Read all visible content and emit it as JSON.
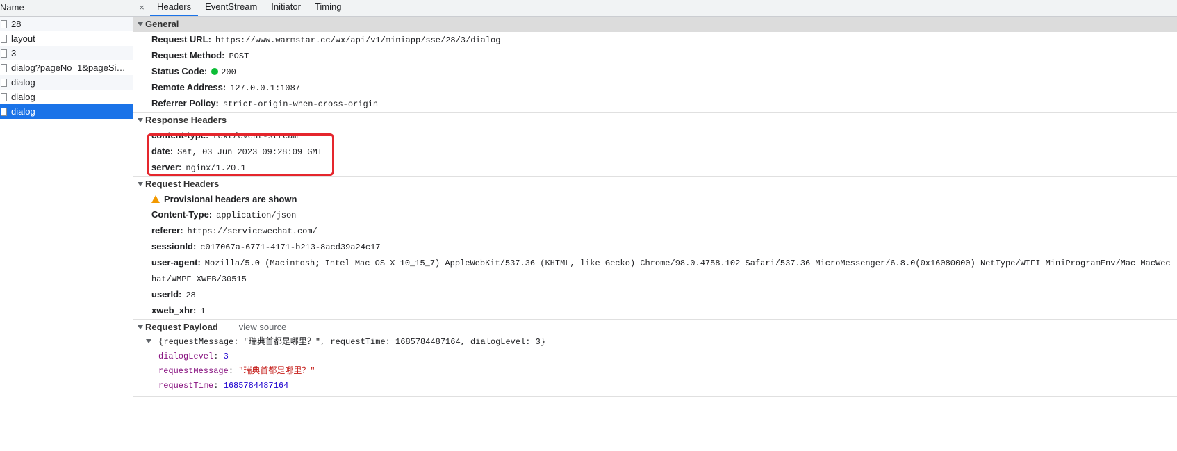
{
  "request_list": {
    "column_header": "Name",
    "items": [
      {
        "name": "28",
        "selected": false
      },
      {
        "name": "layout",
        "selected": false
      },
      {
        "name": "3",
        "selected": false
      },
      {
        "name": "dialog?pageNo=1&pageSize…",
        "selected": false
      },
      {
        "name": "dialog",
        "selected": false
      },
      {
        "name": "dialog",
        "selected": false
      },
      {
        "name": "dialog",
        "selected": true
      }
    ]
  },
  "tabs": {
    "close": "×",
    "items": [
      "Headers",
      "EventStream",
      "Initiator",
      "Timing"
    ],
    "active": "Headers"
  },
  "general": {
    "title": "General",
    "request_url_label": "Request URL:",
    "request_url": "https://www.warmstar.cc/wx/api/v1/miniapp/sse/28/3/dialog",
    "request_method_label": "Request Method:",
    "request_method": "POST",
    "status_code_label": "Status Code:",
    "status_code": "200",
    "remote_address_label": "Remote Address:",
    "remote_address": "127.0.0.1:1087",
    "referrer_policy_label": "Referrer Policy:",
    "referrer_policy": "strict-origin-when-cross-origin"
  },
  "response_headers": {
    "title": "Response Headers",
    "content_type_label": "content-type:",
    "content_type": "text/event-stream",
    "date_label": "date:",
    "date": "Sat, 03 Jun 2023 09:28:09 GMT",
    "server_label": "server:",
    "server": "nginx/1.20.1"
  },
  "request_headers": {
    "title": "Request Headers",
    "provisional": "Provisional headers are shown",
    "content_type_label": "Content-Type:",
    "content_type": "application/json",
    "referer_label": "referer:",
    "referer": "https://servicewechat.com/",
    "session_label": "sessionId:",
    "session": "c017067a-6771-4171-b213-8acd39a24c17",
    "user_agent_label": "user-agent:",
    "user_agent": "Mozilla/5.0 (Macintosh; Intel Mac OS X 10_15_7) AppleWebKit/537.36 (KHTML, like Gecko) Chrome/98.0.4758.102 Safari/537.36 MicroMessenger/6.8.0(0x16080000) NetType/WIFI MiniProgramEnv/Mac MacWechat/WMPF XWEB/30515",
    "user_id_label": "userId:",
    "user_id": "28",
    "xweb_label": "xweb_xhr:",
    "xweb": "1"
  },
  "payload": {
    "title": "Request Payload",
    "view_source": "view source",
    "summary": "{requestMessage: \"瑞典首都是哪里？\", requestTime: 1685784487164, dialogLevel: 3}",
    "dialog_level_key": "dialogLevel",
    "dialog_level": "3",
    "request_message_key": "requestMessage",
    "request_message": "\"瑞典首都是哪里？\"",
    "request_time_key": "requestTime",
    "request_time": "1685784487164"
  },
  "colors": {
    "selected_row": "#1a73e8",
    "status_ok": "#0dbd37",
    "highlight": "#e5262d"
  }
}
